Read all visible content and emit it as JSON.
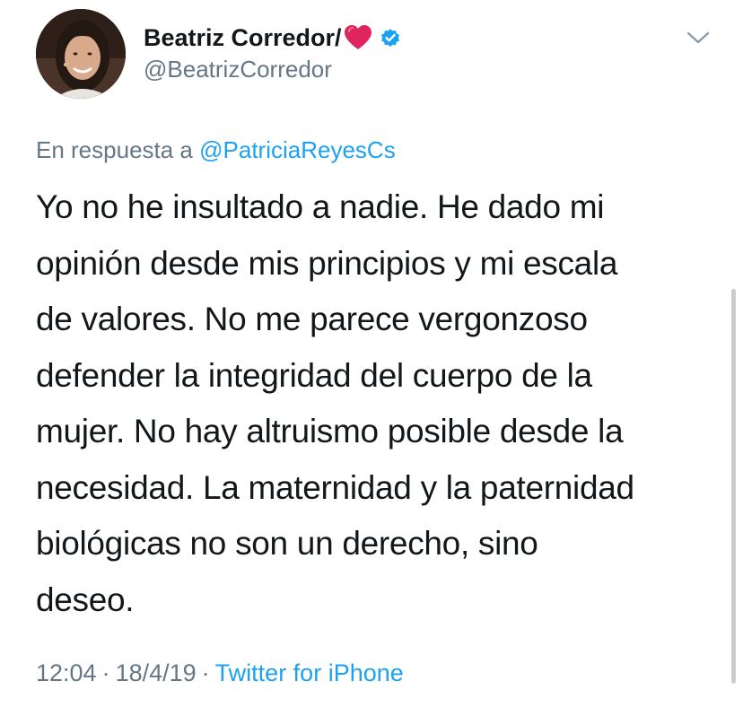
{
  "tweet": {
    "author": {
      "display_name": "Beatriz Corredor/",
      "name_emoji": "heart-icon",
      "verified": true,
      "handle": "@BeatrizCorredor"
    },
    "reply": {
      "prefix": "En respuesta a",
      "mention": "@PatriciaReyesCs"
    },
    "text": "Yo no he insultado a nadie. He dado mi\nopinión desde mis principios y mi escala\nde valores. No me parece vergonzoso\ndefender la integridad del cuerpo de la\nmujer. No hay altruismo posible desde la\nnecesidad. La maternidad y la paternidad\nbiológicas no son un derecho,  sino\ndeseo.",
    "meta": {
      "time": "12:04",
      "date": "18/4/19",
      "separator": "·",
      "source": "Twitter for iPhone"
    }
  },
  "colors": {
    "text": "#14171a",
    "secondary": "#657786",
    "accent": "#1da1f2",
    "heart": "#e0245e"
  },
  "icons": {
    "verified": "verified-badge-icon",
    "menu": "chevron-down-icon"
  }
}
